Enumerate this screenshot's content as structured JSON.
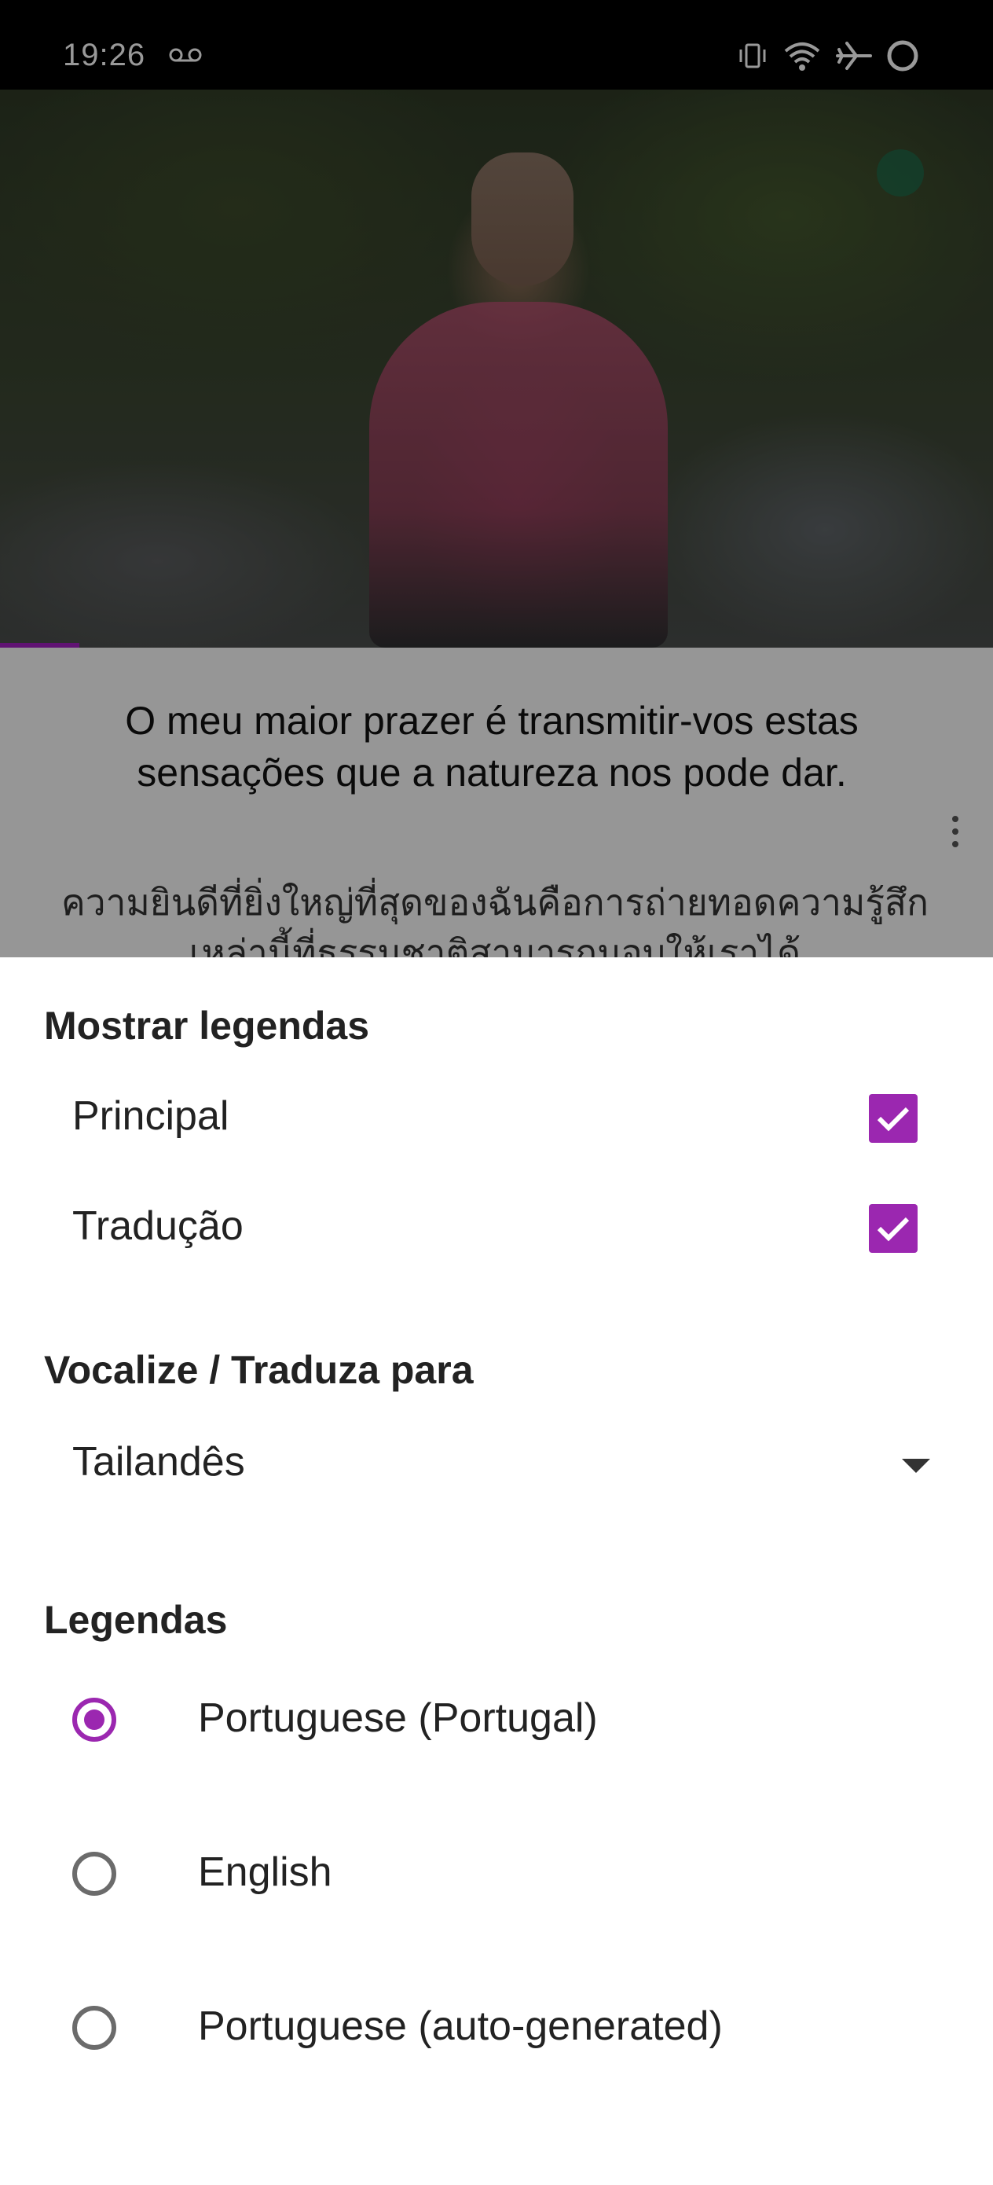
{
  "status_bar": {
    "time": "19:26",
    "icons": [
      "voicemail-icon",
      "vibrate-icon",
      "wifi-icon",
      "airplane-icon",
      "circle-icon"
    ]
  },
  "video": {
    "progress_fraction": 0.08
  },
  "captions": {
    "main": "O meu maior prazer é transmitir-vos estas sensações que a natureza nos pode dar.",
    "translation": "ความยินดีที่ยิ่งใหญ่ที่สุดของฉันคือการถ่ายทอดความรู้สึกเหล่านี้ที่ธรรมชาติสามารถมอบให้เราได้"
  },
  "sheet": {
    "show_subtitles": {
      "title": "Mostrar legendas",
      "options": [
        {
          "label": "Principal",
          "checked": true
        },
        {
          "label": "Tradução",
          "checked": true
        }
      ]
    },
    "translate": {
      "title": "Vocalize / Traduza para",
      "selected": "Tailandês"
    },
    "subtitles": {
      "title": "Legendas",
      "options": [
        {
          "label": "Portuguese (Portugal)",
          "selected": true
        },
        {
          "label": "English",
          "selected": false
        },
        {
          "label": "Portuguese (auto-generated)",
          "selected": false
        }
      ]
    }
  },
  "colors": {
    "accent": "#9b27b0"
  }
}
